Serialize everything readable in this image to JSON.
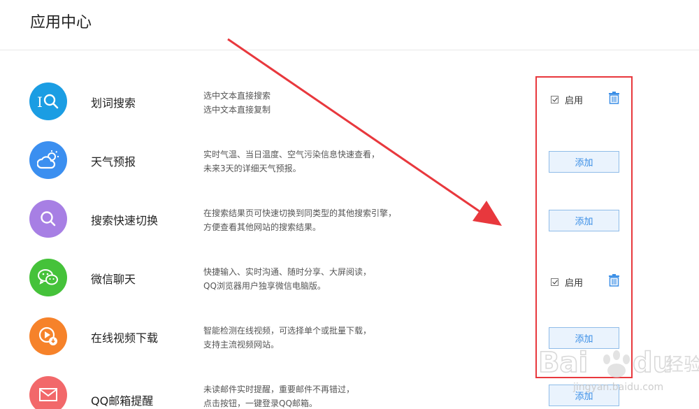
{
  "header": {
    "title": "应用中心"
  },
  "apps": [
    {
      "id": "huaci",
      "name": "划词搜索",
      "desc1": "选中文本直接搜索",
      "desc2": "选中文本直接复制",
      "icon": "word-search-icon",
      "color": "#1b9de3",
      "state": "enabled",
      "enabled_label": "启用"
    },
    {
      "id": "weather",
      "name": "天气预报",
      "desc1": "实时气温、当日温度、空气污染信息快速查看，",
      "desc2": "未来3天的详细天气预报。",
      "icon": "weather-icon",
      "color": "#3b8ff0",
      "state": "add",
      "add_label": "添加"
    },
    {
      "id": "switch",
      "name": "搜索快速切换",
      "desc1": "在搜索结果页可快速切换到同类型的其他搜索引擎，",
      "desc2": "方便查看其他网站的搜索结果。",
      "icon": "search-switch-icon",
      "color": "#a77fe4",
      "state": "add",
      "add_label": "添加"
    },
    {
      "id": "wechat",
      "name": "微信聊天",
      "desc1": "快捷输入、实时沟通、随时分享、大屏阅读，",
      "desc2": "QQ浏览器用户独享微信电脑版。",
      "icon": "wechat-icon",
      "color": "#45c23a",
      "state": "enabled",
      "enabled_label": "启用"
    },
    {
      "id": "video",
      "name": "在线视频下载",
      "desc1": "智能检测在线视频，可选择单个或批量下载，",
      "desc2": "支持主流视频网站。",
      "icon": "video-download-icon",
      "color": "#f6822a",
      "state": "add",
      "add_label": "添加"
    },
    {
      "id": "mail",
      "name": "QQ邮箱提醒",
      "desc1": "未读邮件实时提醒，重要邮件不再错过，",
      "desc2": "点击按钮，一键登录QQ邮箱。",
      "icon": "mail-icon",
      "color": "#f2686a",
      "state": "add",
      "add_label": "添加"
    }
  ],
  "annotation": {
    "color": "#e8383d"
  },
  "watermark": {
    "brand": "Bai",
    "brand2": "du",
    "text": "经验",
    "url": "jingyan.baidu.com"
  }
}
